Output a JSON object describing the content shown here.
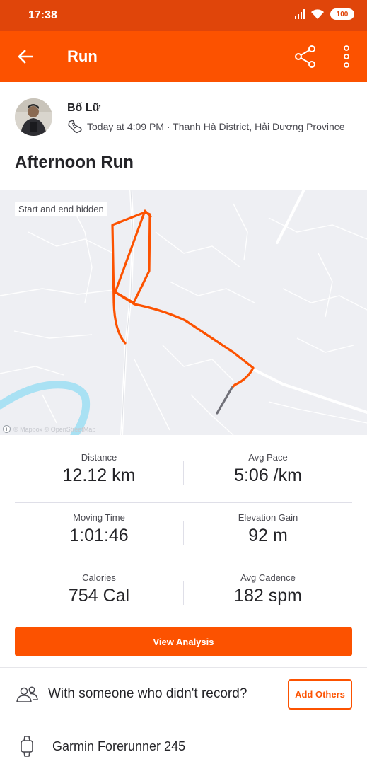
{
  "status_bar": {
    "time": "17:38",
    "battery": "100"
  },
  "header": {
    "title": "Run"
  },
  "athlete": {
    "name": "Bố Lữ",
    "meta": "Today at 4:09 PM · Thanh Hà District, Hải Dương Province"
  },
  "activity": {
    "title": "Afternoon Run"
  },
  "map": {
    "privacy_label": "Start and end hidden",
    "attribution": "© Mapbox © OpenStreetMap",
    "info_glyph": "i"
  },
  "stats": [
    [
      {
        "label": "Distance",
        "value": "12.12 km"
      },
      {
        "label": "Avg Pace",
        "value": "5:06 /km"
      }
    ],
    [
      {
        "label": "Moving Time",
        "value": "1:01:46"
      },
      {
        "label": "Elevation Gain",
        "value": "92 m"
      }
    ],
    [
      {
        "label": "Calories",
        "value": "754 Cal"
      },
      {
        "label": "Avg Cadence",
        "value": "182 spm"
      }
    ]
  ],
  "actions": {
    "view_analysis": "View Analysis",
    "add_others": "Add Others"
  },
  "others_prompt": "With someone who didn't record?",
  "device": {
    "name": "Garmin Forerunner 245"
  },
  "colors": {
    "brand": "#fc5200",
    "status_bar": "#e0450a",
    "route": "#fc5200",
    "water": "#a9e1f3"
  },
  "icons": {
    "back": "arrow-left-icon",
    "share": "share-icon",
    "more": "more-vert-icon",
    "activity_type": "run-shoe-icon",
    "people": "people-icon",
    "device": "watch-icon"
  }
}
